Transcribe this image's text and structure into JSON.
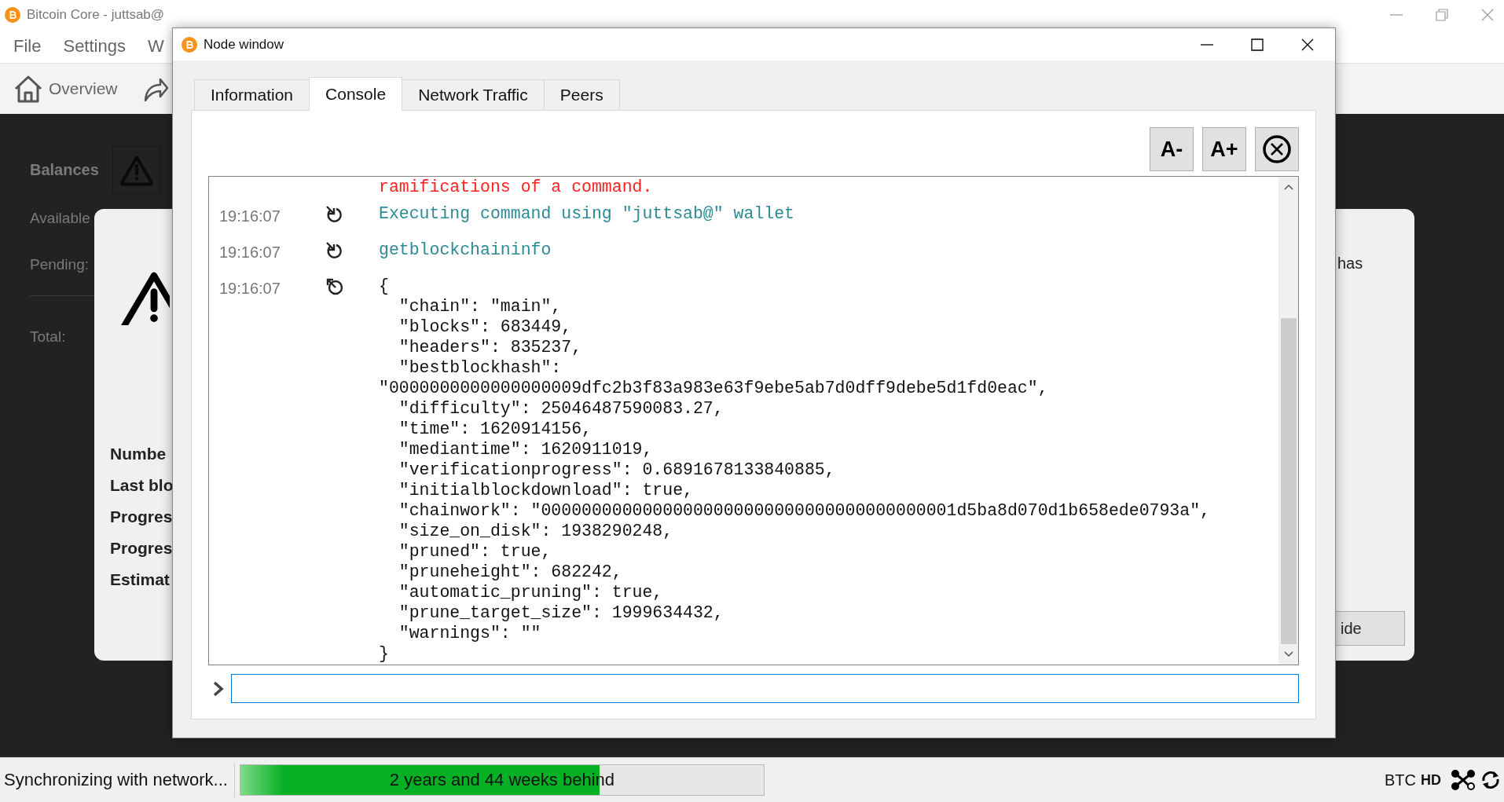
{
  "main_window": {
    "title": "Bitcoin Core - juttsab@",
    "menu": [
      "File",
      "Settings",
      "W"
    ],
    "toolbar": [
      {
        "label": "Overview"
      }
    ],
    "balances": {
      "title": "Balances",
      "rows": [
        "Available",
        "Pending:"
      ],
      "total": "Total:"
    }
  },
  "sync_modal": {
    "labels": [
      "Numbe",
      "Last blo",
      "Progres",
      "Progres",
      "Estimat"
    ],
    "text_fragment": "has",
    "button": "ide"
  },
  "node_window": {
    "title": "Node window",
    "tabs": [
      {
        "label": "Information",
        "selected": false
      },
      {
        "label": "Console",
        "selected": true
      },
      {
        "label": "Network Traffic",
        "selected": false
      },
      {
        "label": "Peers",
        "selected": false
      }
    ],
    "font_buttons": [
      "A-",
      "A+"
    ],
    "messages": [
      {
        "kind": "warning",
        "lines": [
          "ramifications of a command."
        ]
      },
      {
        "kind": "request",
        "time": "19:16:07",
        "lines": [
          "Executing command using \"juttsab@\" wallet"
        ]
      },
      {
        "kind": "request",
        "time": "19:16:07",
        "lines": [
          "getblockchaininfo"
        ]
      },
      {
        "kind": "reply",
        "time": "19:16:07",
        "lines": [
          "{",
          "  \"chain\": \"main\",",
          "  \"blocks\": 683449,",
          "  \"headers\": 835237,",
          "  \"bestblockhash\":",
          "\"0000000000000000009dfc2b3f83a983e63f9ebe5ab7d0dff9debe5d1fd0eac\",",
          "  \"difficulty\": 25046487590083.27,",
          "  \"time\": 1620914156,",
          "  \"mediantime\": 1620911019,",
          "  \"verificationprogress\": 0.6891678133840885,",
          "  \"initialblockdownload\": true,",
          "  \"chainwork\": \"00000000000000000000000000000000000000001d5ba8d070d1b658ede0793a\",",
          "  \"size_on_disk\": 1938290248,",
          "  \"pruned\": true,",
          "  \"pruneheight\": 682242,",
          "  \"automatic_pruning\": true,",
          "  \"prune_target_size\": 1999634432,",
          "  \"warnings\": \"\"",
          "}"
        ]
      }
    ]
  },
  "status_bar": {
    "message": "Synchronizing with network...",
    "progress": {
      "level": 0.687,
      "label": "2 years and 44 weeks behind"
    },
    "unit": "BTC",
    "hd": "HD"
  }
}
